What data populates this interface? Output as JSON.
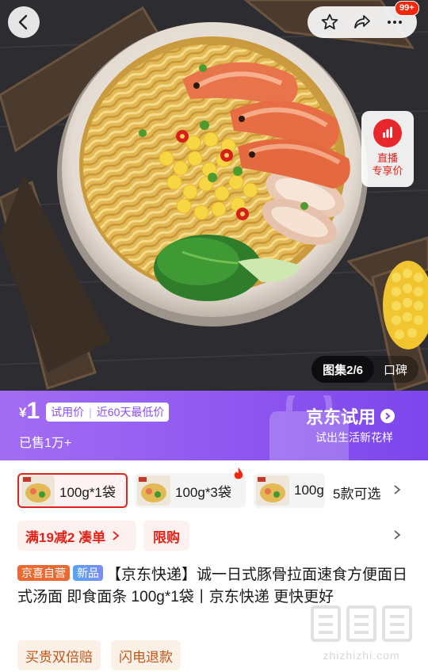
{
  "header": {
    "message_badge": "99+"
  },
  "icons": {
    "back": "back-arrow-icon",
    "favorite": "star-icon",
    "share": "share-icon",
    "more": "more-icon",
    "live": "live-stream-icon"
  },
  "live_promo": {
    "label": "直播\n专享价"
  },
  "gallery": {
    "gallery_tab": "图集2/6",
    "reviews_tab": "口碑"
  },
  "promo": {
    "currency": "¥",
    "price": "1",
    "tag_trial": "试用价",
    "tag_lowest": "近60天最低价",
    "sold": "已售1万+",
    "brand_title": "京东试用",
    "brand_subtitle": "试出生活新花样"
  },
  "variants": {
    "items": [
      {
        "label": "100g*1袋",
        "selected": true
      },
      {
        "label": "100g*3袋",
        "selected": false,
        "hot": true
      },
      {
        "label": "100g",
        "selected": false
      }
    ],
    "more_label": "5款可选"
  },
  "coupons": {
    "discount": "满19减2 凑单",
    "limit": "限购"
  },
  "product": {
    "tag_self": "京喜自营",
    "tag_new": "新品",
    "title": "【京东快递】诚一日式豚骨拉面速食方便面日式汤面 即食面条 100g*1袋丨京东快递 更快更好"
  },
  "guarantees": {
    "items": [
      "买贵双倍赔",
      "闪电退款"
    ]
  },
  "watermark": {
    "logo_text": "值",
    "site": "zhizhizhi.com"
  },
  "colors": {
    "accent_red": "#e2231a",
    "promo_purple": "#8f57f0",
    "guarantee_orange": "#c0561c"
  }
}
